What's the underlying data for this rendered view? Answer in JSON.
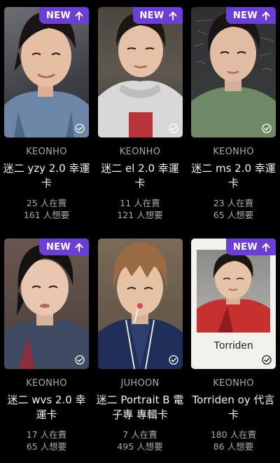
{
  "badge_label": "NEW",
  "colors": {
    "badge": "#6b3fd6",
    "background": "#000000",
    "muted": "#a8a8a8"
  },
  "cards": [
    {
      "artist": "KEONHO",
      "title": "迷二 yzy 2.0 幸運卡",
      "for_sale": "25 人在賣",
      "wanted": "161 人想要",
      "is_new": true
    },
    {
      "artist": "KEONHO",
      "title": "迷二 el 2.0 幸運卡",
      "for_sale": "11 人在賣",
      "wanted": "121 人想要",
      "is_new": true
    },
    {
      "artist": "KEONHO",
      "title": "迷二 ms 2.0 幸運卡",
      "for_sale": "23 人在賣",
      "wanted": "65 人想要",
      "is_new": true
    },
    {
      "artist": "KEONHO",
      "title": "迷二 wvs 2.0 幸運卡",
      "for_sale": "17 人在賣",
      "wanted": "65 人想要",
      "is_new": true
    },
    {
      "artist": "JUHOON",
      "title": "迷二 Portrait B 電子專 專輯卡",
      "for_sale": "7 人在賣",
      "wanted": "495 人想要",
      "is_new": false
    },
    {
      "artist": "KEONHO",
      "title": "Torriden oy 代言卡",
      "for_sale": "180 人在賣",
      "wanted": "86 人想要",
      "is_new": true,
      "photo_caption": "Torriden"
    }
  ]
}
